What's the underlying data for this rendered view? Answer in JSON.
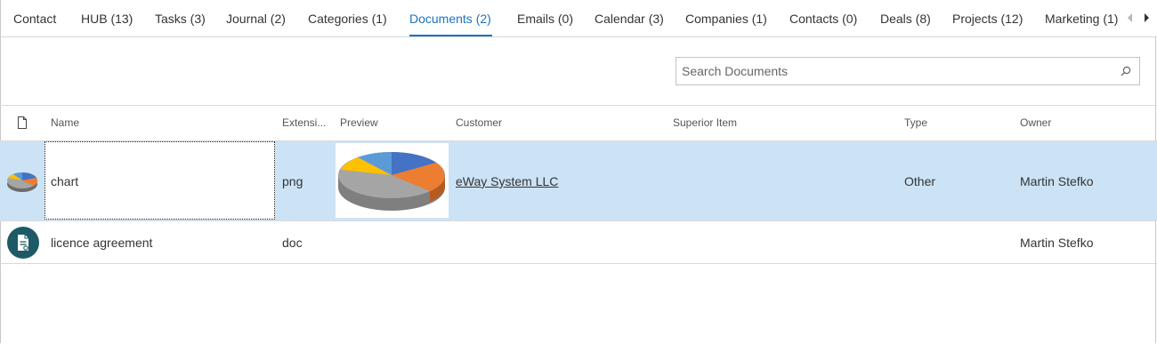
{
  "tabs": [
    {
      "label": "Contact"
    },
    {
      "label": "HUB (13)"
    },
    {
      "label": "Tasks (3)"
    },
    {
      "label": "Journal (2)"
    },
    {
      "label": "Categories (1)"
    },
    {
      "label": "Documents (2)"
    },
    {
      "label": "Emails (0)"
    },
    {
      "label": "Calendar (3)"
    },
    {
      "label": "Companies (1)"
    },
    {
      "label": "Contacts (0)"
    },
    {
      "label": "Deals (8)"
    },
    {
      "label": "Projects (12)"
    },
    {
      "label": "Marketing (1)"
    }
  ],
  "active_tab": "Documents (2)",
  "search": {
    "placeholder": "Search Documents",
    "value": ""
  },
  "columns": {
    "name": "Name",
    "extension": "Extensi...",
    "preview": "Preview",
    "customer": "Customer",
    "superior_item": "Superior Item",
    "type": "Type",
    "owner": "Owner"
  },
  "rows": [
    {
      "name": "chart",
      "extension": "png",
      "customer": "eWay System LLC",
      "superior_item": "",
      "type": "Other",
      "owner": "Martin Stefko",
      "selected": true
    },
    {
      "name": "licence agreement",
      "extension": "doc",
      "customer": "",
      "superior_item": "",
      "type": "",
      "owner": "Martin Stefko",
      "selected": false
    }
  ],
  "colors": {
    "accent": "#1a73c5",
    "selection": "#cce3f5",
    "doc_avatar": "#1e5a66"
  }
}
